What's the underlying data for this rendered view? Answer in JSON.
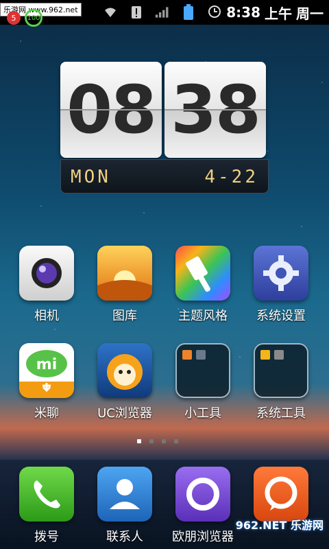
{
  "status": {
    "watermark": "乐游网 www.962.net",
    "badge_count": "5",
    "battery_circle": "100",
    "time": "8:38",
    "ampm": "上午",
    "weekday": "周一"
  },
  "clock": {
    "hour": "08",
    "minute": "38",
    "day": "MON",
    "date": "4-22"
  },
  "apps": [
    {
      "label": "相机",
      "icon": "camera-icon",
      "color": "#e8e8e8"
    },
    {
      "label": "图库",
      "icon": "gallery-icon",
      "color": "#f2a11a"
    },
    {
      "label": "主题风格",
      "icon": "theme-brush-icon",
      "color": "#9b59d6"
    },
    {
      "label": "系统设置",
      "icon": "gear-icon",
      "color": "#3f56b5"
    },
    {
      "label": "米聊",
      "icon": "miliao-icon",
      "color": "#f39c12"
    },
    {
      "label": "UC浏览器",
      "icon": "uc-browser-icon",
      "color": "#1e5aa8"
    },
    {
      "label": "小工具",
      "icon": "folder-icon",
      "color": "#0d2230"
    },
    {
      "label": "系统工具",
      "icon": "folder-icon",
      "color": "#0d2230"
    }
  ],
  "dock": [
    {
      "label": "拨号",
      "icon": "phone-icon",
      "color": "#48b82c"
    },
    {
      "label": "联系人",
      "icon": "contacts-icon",
      "color": "#2e86d6"
    },
    {
      "label": "欧朋浏览器",
      "icon": "opera-icon",
      "color": "#7a4ed6"
    },
    {
      "label": "",
      "icon": "chat-bubble-icon",
      "color": "#e8521c"
    }
  ],
  "page_indicator": {
    "pages": 4,
    "current": 1
  },
  "overlay_watermark": "962.NET 乐游网"
}
